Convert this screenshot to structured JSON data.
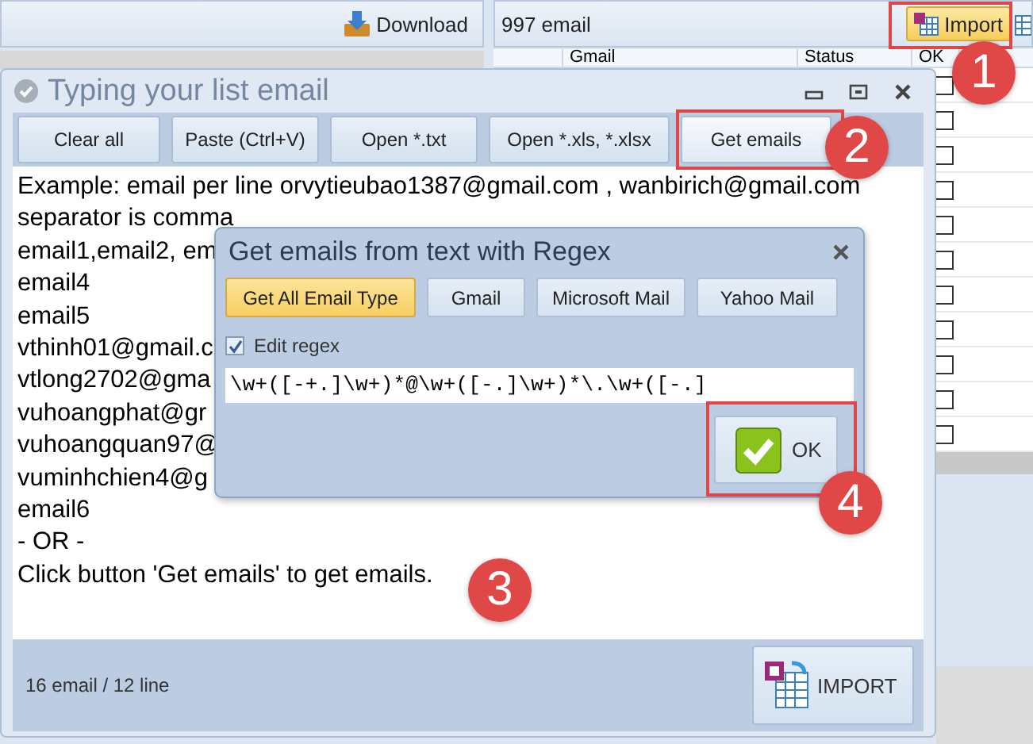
{
  "main": {
    "download_button": "Download",
    "email_count": "997 email",
    "import_button": {
      "label": "Import",
      "selected": true
    },
    "grid": {
      "columns": [
        "Gmail",
        "Status",
        "OK"
      ],
      "rows": [
        {
          "checked": false
        },
        {
          "checked": false
        },
        {
          "checked": false
        },
        {
          "checked": false
        },
        {
          "checked": false
        },
        {
          "checked": false
        },
        {
          "checked": false
        },
        {
          "checked": false
        },
        {
          "checked": false
        },
        {
          "checked": false
        },
        {
          "checked": false
        }
      ]
    }
  },
  "typing_window": {
    "title": "Typing your list email",
    "toolbar": [
      "Clear all",
      "Paste (Ctrl+V)",
      "Open *.txt",
      "Open *.xls, *.xlsx",
      "Get emails"
    ],
    "lines": [
      "Example: email per line orvytieubao1387@gmail.com , wanbirich@gmail.com",
      "separator is comma",
      "email1,email2, em",
      "email4",
      "email5",
      "vthinh01@gmail.c",
      "vtlong2702@gma",
      "vuhoangphat@gr",
      "vuhoangquan97@",
      "vuminhchien4@g",
      "email6",
      "- OR -",
      "Click button 'Get emails' to get emails."
    ],
    "status": "16 email / 12 line",
    "import_button": "IMPORT"
  },
  "regex_dialog": {
    "title": "Get emails from text with Regex",
    "types": [
      {
        "label": "Get All Email Type",
        "selected": true
      },
      {
        "label": "Gmail",
        "selected": false
      },
      {
        "label": "Microsoft Mail",
        "selected": false
      },
      {
        "label": "Yahoo Mail",
        "selected": false
      }
    ],
    "edit_regex": {
      "label": "Edit regex",
      "checked": true
    },
    "regex": "\\w+([-+.]\\w+)*@\\w+([-.]\\w+)*\\.\\w+([-.]",
    "ok_button": "OK"
  },
  "steps": [
    {
      "number": "1"
    },
    {
      "number": "2"
    },
    {
      "number": "3"
    },
    {
      "number": "4"
    }
  ]
}
